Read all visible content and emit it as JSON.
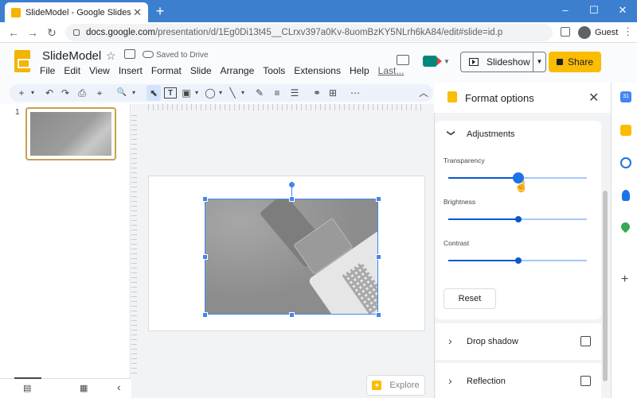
{
  "browser": {
    "tab_title": "SlideModel - Google Slides",
    "tab_close": "✕",
    "new_tab": "+",
    "url_domain": "docs.google.com",
    "url_path": "/presentation/d/1Eg0Di13t45__CLrxv397a0Kv-8uomBzKY5NLrh6kA84/edit#slide=id.p",
    "profile_name": "Guest",
    "window_controls": [
      "‒",
      "☐",
      "✕"
    ],
    "nav_icons": [
      "←",
      "→",
      "↻"
    ]
  },
  "doc": {
    "title": "SlideModel",
    "saved_status": "Saved to Drive",
    "menu": [
      "File",
      "Edit",
      "View",
      "Insert",
      "Format",
      "Slide",
      "Arrange",
      "Tools",
      "Extensions",
      "Help"
    ],
    "last_edit": "Last...",
    "slideshow_label": "Slideshow",
    "share_label": "Share",
    "accent": "#fbbc04"
  },
  "toolbar": {
    "icons": [
      "+",
      "▾",
      "↶",
      "↷",
      "⎙",
      "⌖",
      "🔍",
      "▾",
      "⬉",
      "T",
      "▣",
      "▾",
      "◯",
      "▾",
      "╲",
      "▾",
      "✎",
      "≡",
      "☰",
      "⚭",
      "⊞",
      "⋯",
      "︿"
    ]
  },
  "filmstrip": {
    "slide_number": "1",
    "bottom_icons": [
      "▤",
      "▦",
      "‹"
    ]
  },
  "canvas": {
    "explore_label": "Explore",
    "explore_icon": "✦"
  },
  "format_panel": {
    "title": "Format options",
    "close": "✕",
    "adjustments": {
      "title": "Adjustments",
      "chevron": "❯",
      "sliders": [
        {
          "label": "Transparency",
          "value": 0.5
        },
        {
          "label": "Brightness",
          "value": 0.5
        },
        {
          "label": "Contrast",
          "value": 0.5
        }
      ],
      "reset_label": "Reset"
    },
    "collapsed_sections": [
      {
        "title": "Drop shadow",
        "checked": false
      },
      {
        "title": "Reflection",
        "checked": false
      }
    ],
    "chevron_collapsed": "›"
  },
  "side_rail": {
    "icons": [
      "calendar-icon",
      "keep-icon",
      "tasks-icon",
      "contacts-icon",
      "maps-icon",
      "add-icon"
    ],
    "add": "+",
    "calendar_text": "31"
  }
}
